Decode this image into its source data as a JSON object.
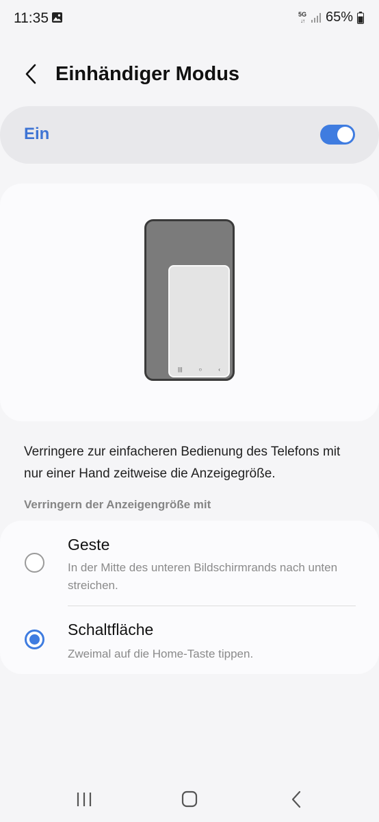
{
  "status_bar": {
    "time": "11:35",
    "network": "5G",
    "battery": "65%"
  },
  "header": {
    "title": "Einhändiger Modus"
  },
  "master_toggle": {
    "label": "Ein",
    "state": "on",
    "accent_color": "#3f7ce0"
  },
  "description": "Verringere zur einfacheren Bedienung des Telefons mit nur einer Hand zeitweise die Anzeigegröße.",
  "section": {
    "header": "Verringern der Anzeigengröße mit"
  },
  "options": [
    {
      "title": "Geste",
      "subtitle": "In der Mitte des unteren Bildschirmrands nach unten streichen.",
      "selected": false
    },
    {
      "title": "Schaltfläche",
      "subtitle": "Zweimal auf die Home-Taste tippen.",
      "selected": true
    }
  ],
  "icons": {
    "status_gallery": "image-icon",
    "signal": "signal-icon",
    "battery": "battery-icon",
    "back": "chevron-left-icon",
    "nav_recents": "recents-icon",
    "nav_home": "home-icon",
    "nav_back": "back-icon"
  }
}
